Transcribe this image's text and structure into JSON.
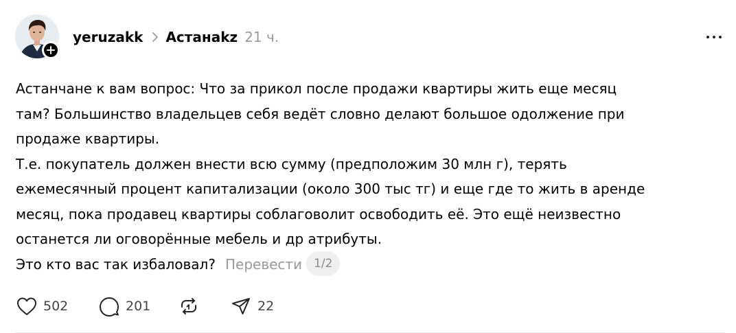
{
  "post": {
    "author": "yeruzakk",
    "community": "Астанаkz",
    "time": "21 ч.",
    "body_lines": [
      "Астанчане к вам вопрос: Что за прикол после продажи квартиры жить еще месяц",
      "там? Большинство владельцев себя ведёт словно делают большое одолжение при",
      "продаже квартиры.",
      "Т.е. покупатель должен внести всю сумму (предположим 30 млн г), терять",
      "ежемесячный процент капитализации (около 300 тыс тг) и еще где то жить в аренде",
      "месяц, пока продавец квартиры соблаговолит освободить её. Это ещё неизвестно",
      "останется ли оговорённые мебель и др атрибуты.",
      "Это кто вас так избаловал?"
    ],
    "translate_label": "Перевести",
    "page_indicator": "1/2"
  },
  "actions": {
    "likes": "502",
    "replies": "201",
    "shares": "22"
  },
  "icons": {
    "follow": "plus-icon",
    "crumb": "chevron-right-icon",
    "more": "more-horizontal-icon",
    "like": "heart-icon",
    "reply": "comment-icon",
    "repost": "repost-icon",
    "share": "send-icon"
  }
}
